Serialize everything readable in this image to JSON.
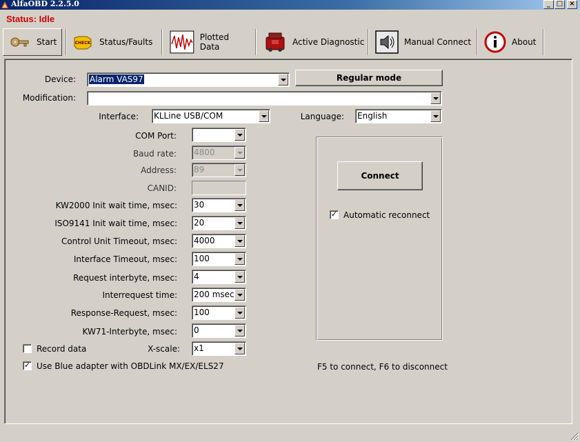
{
  "window": {
    "title": "AlfaOBD 2.2.5.0"
  },
  "status": {
    "text": "Status: Idle",
    "color": "#d10000"
  },
  "toolbar": {
    "items": [
      {
        "label": "Start",
        "icon": "key-icon",
        "active": true
      },
      {
        "label": "Status/Faults",
        "icon": "check-engine-icon"
      },
      {
        "label": "Plotted Data",
        "icon": "waveform-icon"
      },
      {
        "label": "Active Diagnostic",
        "icon": "engine-icon"
      },
      {
        "label": "Manual Connect",
        "icon": "speaker-icon"
      },
      {
        "label": "About",
        "icon": "info-icon"
      }
    ]
  },
  "form": {
    "device_label": "Device:",
    "device_value": "Alarm VAS97",
    "mode_button": "Regular mode",
    "modification_label": "Modification:",
    "modification_value": "",
    "interface_label": "Interface:",
    "interface_value": "KLLine USB/COM",
    "language_label": "Language:",
    "language_value": "English",
    "com_port_label": "COM Port:",
    "com_port_value": "",
    "baud_rate_label": "Baud rate:",
    "baud_rate_value": "4800",
    "address_label": "Address:",
    "address_value": "89",
    "canid_label": "CANID:",
    "canid_value": "",
    "kw2000_label": "KW2000 Init wait time, msec:",
    "kw2000_value": "30",
    "iso9141_label": "ISO9141 Init wait time, msec:",
    "iso9141_value": "20",
    "cu_timeout_label": "Control Unit Timeout, msec:",
    "cu_timeout_value": "4000",
    "if_timeout_label": "Interface Timeout, msec:",
    "if_timeout_value": "100",
    "req_interbyte_label": "Request interbyte, msec:",
    "req_interbyte_value": "4",
    "interrequest_label": "Interrequest time:",
    "interrequest_value": "200 msec",
    "resp_req_label": "Response-Request, msec:",
    "resp_req_value": "100",
    "kw71_label": "KW71-Interbyte, msec:",
    "kw71_value": "0",
    "record_data_label": "Record data",
    "record_data_checked": false,
    "xscale_label": "X-scale:",
    "xscale_value": "x1",
    "blue_adapter_label": "Use Blue adapter with OBDLink MX/EX/ELS27",
    "blue_adapter_checked": true
  },
  "connect": {
    "button": "Connect",
    "auto_reconnect_label": "Automatic reconnect",
    "auto_reconnect_checked": true,
    "hint": "F5 to connect, F6 to disconnect"
  }
}
